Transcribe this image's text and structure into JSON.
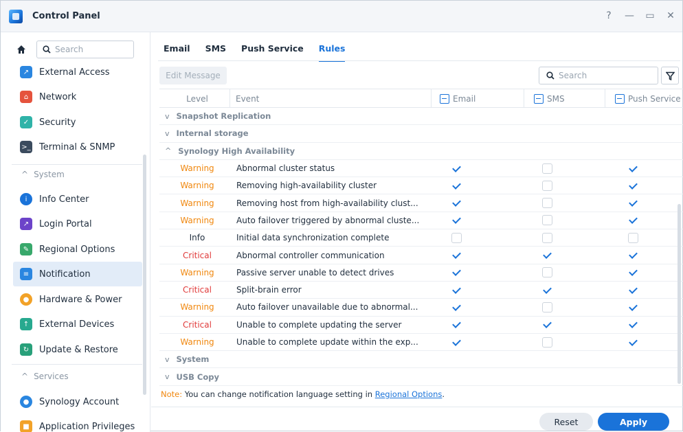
{
  "window": {
    "title": "Control Panel",
    "controls": [
      "?",
      "—",
      "▭",
      "✕"
    ]
  },
  "sidebar": {
    "search_placeholder": "Search",
    "items": [
      {
        "label": "External Access",
        "icon": "external-access-icon",
        "color": "#2a86e0"
      },
      {
        "label": "Network",
        "icon": "network-icon",
        "color": "#e5533d"
      },
      {
        "label": "Security",
        "icon": "shield-icon",
        "color": "#2fb3a8"
      },
      {
        "label": "Terminal & SNMP",
        "icon": "terminal-icon",
        "color": "#3b4b5e"
      },
      {
        "label": "Info Center",
        "icon": "info-icon",
        "color": "#1a73d9"
      },
      {
        "label": "Login Portal",
        "icon": "login-portal-icon",
        "color": "#6c43c9"
      },
      {
        "label": "Regional Options",
        "icon": "regional-options-icon",
        "color": "#38a86b"
      },
      {
        "label": "Notification",
        "icon": "notification-icon",
        "color": "#2a86e0"
      },
      {
        "label": "Hardware & Power",
        "icon": "bulb-icon",
        "color": "#f2a228"
      },
      {
        "label": "External Devices",
        "icon": "external-devices-icon",
        "color": "#27a98f"
      },
      {
        "label": "Update & Restore",
        "icon": "update-restore-icon",
        "color": "#28a07a"
      },
      {
        "label": "Synology Account",
        "icon": "account-icon",
        "color": "#2a86e0"
      },
      {
        "label": "Application Privileges",
        "icon": "lock-icon",
        "color": "#f2a228"
      }
    ],
    "sections": {
      "system": "System",
      "services": "Services"
    },
    "active_item": "Notification"
  },
  "tabs": [
    {
      "label": "Email",
      "active": false
    },
    {
      "label": "SMS",
      "active": false
    },
    {
      "label": "Push Service",
      "active": false
    },
    {
      "label": "Rules",
      "active": true
    }
  ],
  "toolbar": {
    "edit_label": "Edit Message",
    "search_placeholder": "Search"
  },
  "table": {
    "headers": {
      "level": "Level",
      "event": "Event",
      "email": "Email",
      "sms": "SMS",
      "push": "Push Service"
    },
    "groups_before": [
      {
        "label": "Snapshot Replication",
        "expanded": false
      },
      {
        "label": "Internal storage",
        "expanded": false
      },
      {
        "label": "Synology High Availability",
        "expanded": true
      }
    ],
    "rows": [
      {
        "level": "Warning",
        "event": "Abnormal cluster status",
        "email": true,
        "sms": false,
        "push": true
      },
      {
        "level": "Warning",
        "event": "Removing high-availability cluster",
        "email": true,
        "sms": false,
        "push": true
      },
      {
        "level": "Warning",
        "event": "Removing host from high-availability clust...",
        "email": true,
        "sms": false,
        "push": true
      },
      {
        "level": "Warning",
        "event": "Auto failover triggered by abnormal cluste...",
        "email": true,
        "sms": false,
        "push": true
      },
      {
        "level": "Info",
        "event": "Initial data synchronization complete",
        "email": false,
        "sms": false,
        "push": false
      },
      {
        "level": "Critical",
        "event": "Abnormal controller communication",
        "email": true,
        "sms": true,
        "push": true
      },
      {
        "level": "Warning",
        "event": "Passive server unable to detect drives",
        "email": true,
        "sms": false,
        "push": true
      },
      {
        "level": "Critical",
        "event": "Split-brain error",
        "email": true,
        "sms": true,
        "push": true
      },
      {
        "level": "Warning",
        "event": "Auto failover unavailable due to abnormal...",
        "email": true,
        "sms": false,
        "push": true
      },
      {
        "level": "Critical",
        "event": "Unable to complete updating the server",
        "email": true,
        "sms": true,
        "push": true
      },
      {
        "level": "Warning",
        "event": "Unable to complete update within the exp...",
        "email": true,
        "sms": false,
        "push": true
      }
    ],
    "groups_after": [
      {
        "label": "System",
        "expanded": false
      },
      {
        "label": "USB Copy",
        "expanded": false
      }
    ]
  },
  "note": {
    "key": "Note:",
    "text": " You can change notification language setting in ",
    "link": "Regional Options",
    "tail": "."
  },
  "footer": {
    "reset_label": "Reset",
    "apply_label": "Apply"
  }
}
